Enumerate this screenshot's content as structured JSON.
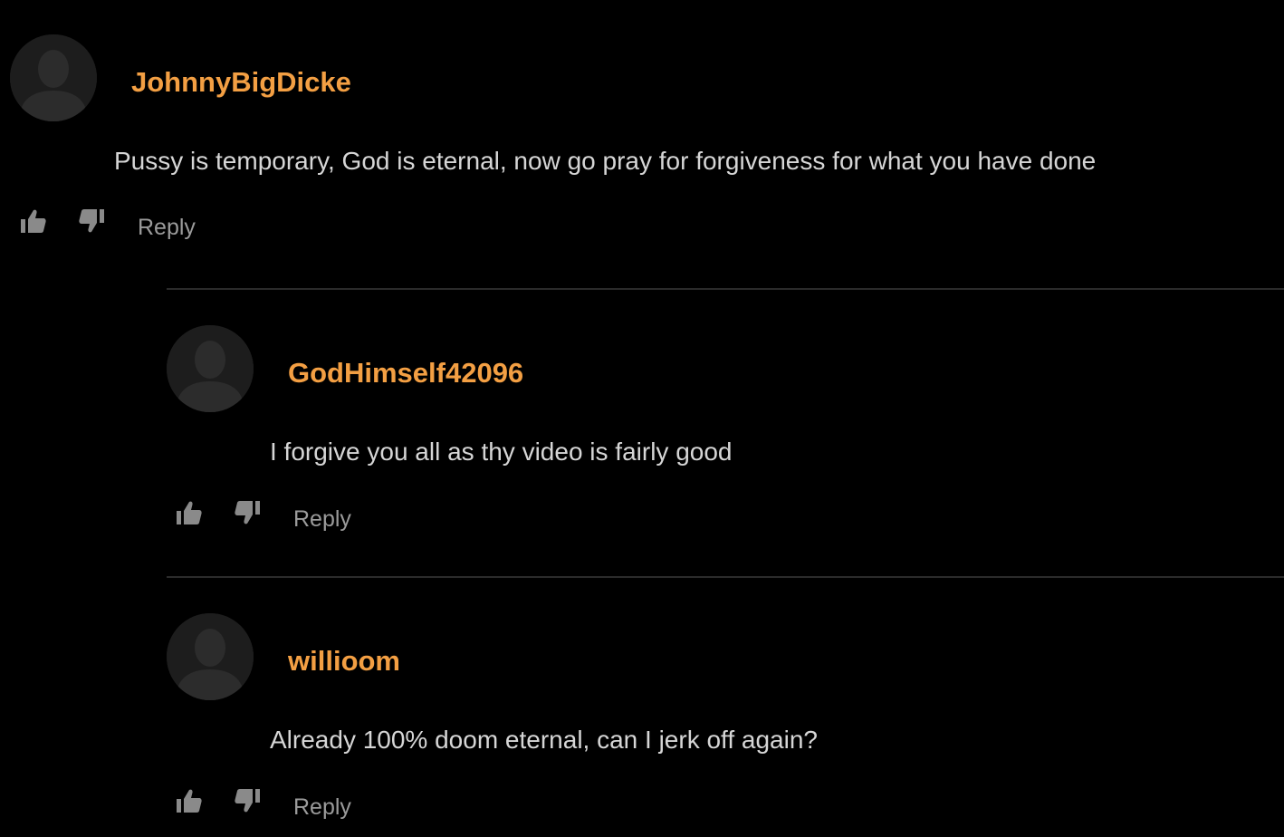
{
  "comments": [
    {
      "username": "JohnnyBigDicke",
      "text": "Pussy is temporary, God is eternal, now go pray for forgiveness for what you have done",
      "reply_label": "Reply"
    },
    {
      "username": "GodHimself42096",
      "text": "I forgive you all as thy video is fairly good",
      "reply_label": "Reply"
    },
    {
      "username": "willioom",
      "text": "Already 100% doom eternal, can I jerk off again?",
      "reply_label": "Reply"
    }
  ],
  "colors": {
    "background": "#000000",
    "username": "#f39f43",
    "comment_text": "#d6d6d6",
    "reply_text": "#9b9b9b",
    "icon": "#8a8a8a",
    "avatar_bg": "#1d1d1d",
    "avatar_figure": "#2c2c2c",
    "divider": "#2b2b2b"
  },
  "icons": {
    "avatar": "default-user-silhouette",
    "like": "thumbs-up-icon",
    "dislike": "thumbs-down-icon"
  }
}
